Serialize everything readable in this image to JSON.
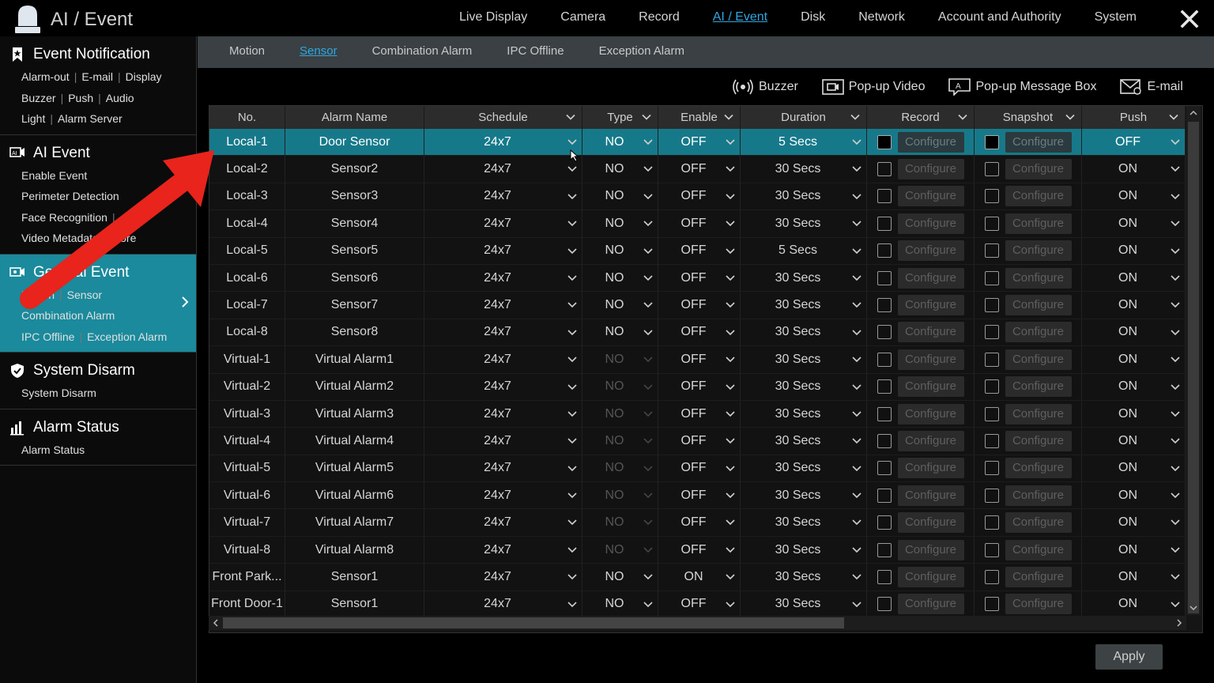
{
  "app": {
    "title": "AI / Event"
  },
  "topnav": [
    "Live Display",
    "Camera",
    "Record",
    "AI / Event",
    "Disk",
    "Network",
    "Account and Authority",
    "System"
  ],
  "topnav_active": "AI / Event",
  "sidebar": {
    "groups": [
      {
        "title": "Event Notification",
        "icon": "bookmark-star-icon",
        "lines": [
          [
            "Alarm-out",
            "E-mail",
            "Display"
          ],
          [
            "Buzzer",
            "Push",
            "Audio"
          ],
          [
            "Light",
            "Alarm Server"
          ]
        ]
      },
      {
        "title": "AI Event",
        "icon": "ai-camera-icon",
        "lines": [
          [
            "Enable Event"
          ],
          [
            "Perimeter Detection"
          ],
          [
            "Face Recognition",
            "..."
          ],
          [
            "Video Metadata",
            "More"
          ]
        ]
      },
      {
        "title": "General Event",
        "icon": "camera-settings-icon",
        "lines": [
          [
            "Motion",
            "Sensor"
          ],
          [
            "Combination Alarm"
          ],
          [
            "IPC Offline",
            "Exception Alarm"
          ]
        ]
      },
      {
        "title": "System Disarm",
        "icon": "shield-check-icon",
        "lines": [
          [
            "System Disarm"
          ]
        ]
      },
      {
        "title": "Alarm Status",
        "icon": "bar-status-icon",
        "lines": [
          [
            "Alarm Status"
          ]
        ]
      }
    ]
  },
  "subtabs": [
    "Motion",
    "Sensor",
    "Combination Alarm",
    "IPC Offline",
    "Exception Alarm"
  ],
  "subtab_active": "Sensor",
  "actions": [
    {
      "label": "Buzzer",
      "icon": "buzzer-icon"
    },
    {
      "label": "Pop-up Video",
      "icon": "popup-video-icon"
    },
    {
      "label": "Pop-up Message Box",
      "icon": "popup-message-icon"
    },
    {
      "label": "E-mail",
      "icon": "email-icon"
    }
  ],
  "table": {
    "headers": [
      "No.",
      "Alarm Name",
      "Schedule",
      "Type",
      "Enable",
      "Duration",
      "Record",
      "Snapshot",
      "Push"
    ],
    "configure_label": "Configure",
    "rows": [
      {
        "no": "Local-1",
        "name": "Door Sensor",
        "schedule": "24x7",
        "type": "NO",
        "type_enabled": true,
        "enable": "OFF",
        "duration": "5 Secs",
        "push": "OFF",
        "selected": true
      },
      {
        "no": "Local-2",
        "name": "Sensor2",
        "schedule": "24x7",
        "type": "NO",
        "type_enabled": true,
        "enable": "OFF",
        "duration": "30 Secs",
        "push": "ON"
      },
      {
        "no": "Local-3",
        "name": "Sensor3",
        "schedule": "24x7",
        "type": "NO",
        "type_enabled": true,
        "enable": "OFF",
        "duration": "30 Secs",
        "push": "ON"
      },
      {
        "no": "Local-4",
        "name": "Sensor4",
        "schedule": "24x7",
        "type": "NO",
        "type_enabled": true,
        "enable": "OFF",
        "duration": "30 Secs",
        "push": "ON"
      },
      {
        "no": "Local-5",
        "name": "Sensor5",
        "schedule": "24x7",
        "type": "NO",
        "type_enabled": true,
        "enable": "OFF",
        "duration": "5 Secs",
        "push": "ON"
      },
      {
        "no": "Local-6",
        "name": "Sensor6",
        "schedule": "24x7",
        "type": "NO",
        "type_enabled": true,
        "enable": "OFF",
        "duration": "30 Secs",
        "push": "ON"
      },
      {
        "no": "Local-7",
        "name": "Sensor7",
        "schedule": "24x7",
        "type": "NO",
        "type_enabled": true,
        "enable": "OFF",
        "duration": "30 Secs",
        "push": "ON"
      },
      {
        "no": "Local-8",
        "name": "Sensor8",
        "schedule": "24x7",
        "type": "NO",
        "type_enabled": true,
        "enable": "OFF",
        "duration": "30 Secs",
        "push": "ON"
      },
      {
        "no": "Virtual-1",
        "name": "Virtual Alarm1",
        "schedule": "24x7",
        "type": "NO",
        "type_enabled": false,
        "enable": "OFF",
        "duration": "30 Secs",
        "push": "ON"
      },
      {
        "no": "Virtual-2",
        "name": "Virtual Alarm2",
        "schedule": "24x7",
        "type": "NO",
        "type_enabled": false,
        "enable": "OFF",
        "duration": "30 Secs",
        "push": "ON"
      },
      {
        "no": "Virtual-3",
        "name": "Virtual Alarm3",
        "schedule": "24x7",
        "type": "NO",
        "type_enabled": false,
        "enable": "OFF",
        "duration": "30 Secs",
        "push": "ON"
      },
      {
        "no": "Virtual-4",
        "name": "Virtual Alarm4",
        "schedule": "24x7",
        "type": "NO",
        "type_enabled": false,
        "enable": "OFF",
        "duration": "30 Secs",
        "push": "ON"
      },
      {
        "no": "Virtual-5",
        "name": "Virtual Alarm5",
        "schedule": "24x7",
        "type": "NO",
        "type_enabled": false,
        "enable": "OFF",
        "duration": "30 Secs",
        "push": "ON"
      },
      {
        "no": "Virtual-6",
        "name": "Virtual Alarm6",
        "schedule": "24x7",
        "type": "NO",
        "type_enabled": false,
        "enable": "OFF",
        "duration": "30 Secs",
        "push": "ON"
      },
      {
        "no": "Virtual-7",
        "name": "Virtual Alarm7",
        "schedule": "24x7",
        "type": "NO",
        "type_enabled": false,
        "enable": "OFF",
        "duration": "30 Secs",
        "push": "ON"
      },
      {
        "no": "Virtual-8",
        "name": "Virtual Alarm8",
        "schedule": "24x7",
        "type": "NO",
        "type_enabled": false,
        "enable": "OFF",
        "duration": "30 Secs",
        "push": "ON"
      },
      {
        "no": "Front Park...",
        "name": "Sensor1",
        "schedule": "24x7",
        "type": "NO",
        "type_enabled": true,
        "enable": "ON",
        "duration": "30 Secs",
        "push": "ON"
      },
      {
        "no": "Front Door-1",
        "name": "Sensor1",
        "schedule": "24x7",
        "type": "NO",
        "type_enabled": true,
        "enable": "OFF",
        "duration": "30 Secs",
        "push": "ON"
      }
    ]
  },
  "apply_label": "Apply",
  "colors": {
    "accent": "#2ea7e0",
    "selected_row": "#16798a",
    "active_group": "#1a8a9c",
    "annotation_arrow": "#e8241c"
  }
}
